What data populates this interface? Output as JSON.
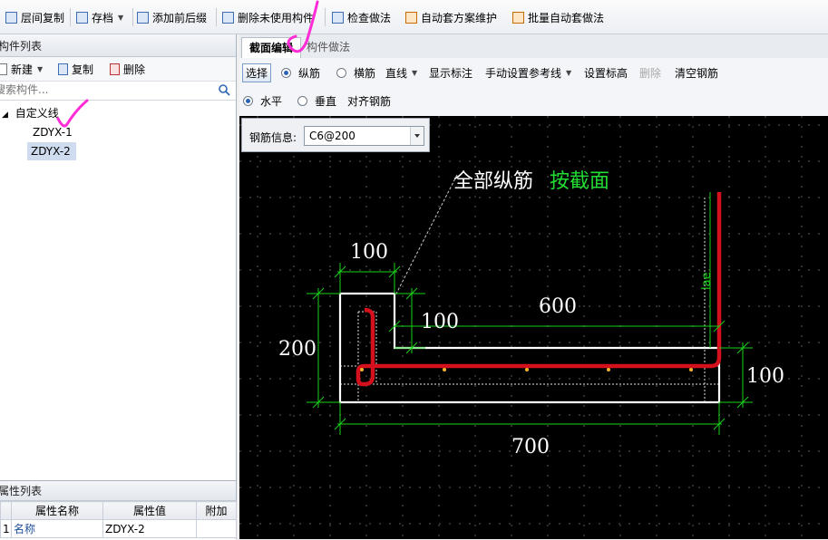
{
  "toolbar": {
    "items": [
      {
        "label": "层间复制",
        "icon": "copy-floors-icon"
      },
      {
        "label": "存档",
        "icon": "archive-icon"
      },
      {
        "label": "添加前后缀",
        "icon": "add-prefix-icon"
      },
      {
        "label": "删除未使用构件",
        "icon": "delete-unused-icon"
      },
      {
        "label": "检查做法",
        "icon": "check-method-icon"
      },
      {
        "label": "自动套方案维护",
        "icon": "auto-scheme-icon"
      },
      {
        "label": "批量自动套做法",
        "icon": "batch-auto-icon"
      }
    ]
  },
  "component_list": {
    "title": "构件列表",
    "new_label": "新建",
    "copy_label": "复制",
    "delete_label": "删除",
    "search_placeholder": "搜索构件...",
    "tree": {
      "root": "自定义线",
      "children": [
        "ZDYX-1",
        "ZDYX-2"
      ],
      "selected": "ZDYX-2"
    }
  },
  "property_list": {
    "title": "属性列表",
    "columns": [
      "属性名称",
      "属性值",
      "附加"
    ],
    "rows": [
      {
        "index": "1",
        "name": "名称",
        "value": "ZDYX-2",
        "extra": ""
      }
    ]
  },
  "tabs": [
    {
      "label": "截面编辑",
      "active": true
    },
    {
      "label": "构件做法",
      "active": false
    }
  ],
  "edit_toolbar": {
    "row1": {
      "select": "选择",
      "longitudinal": "纵筋",
      "transverse": "横筋",
      "line": "直线",
      "show_dim": "显示标注",
      "manual_ref": "手动设置参考线",
      "set_elev": "设置标高",
      "delete": "删除",
      "clear": "清空钢筋"
    },
    "row2": {
      "horizontal": "水平",
      "vertical": "垂直",
      "align": "对齐钢筋"
    }
  },
  "rebar_info": {
    "label": "钢筋信息:",
    "value": "C6@200"
  },
  "drawing": {
    "annotation_white": "全部纵筋",
    "annotation_green": "按截面",
    "dims": {
      "top_width": "100",
      "step_height": "100",
      "flange_length": "600",
      "total_height": "200",
      "bottom_thickness": "100",
      "total_width": "700",
      "anchor": "lae"
    },
    "colors": {
      "canvas": "#000000",
      "dim_line": "#19d219",
      "outline": "#ffffff",
      "rebar": "#d4101c",
      "accent_text": "#22dd33"
    }
  }
}
